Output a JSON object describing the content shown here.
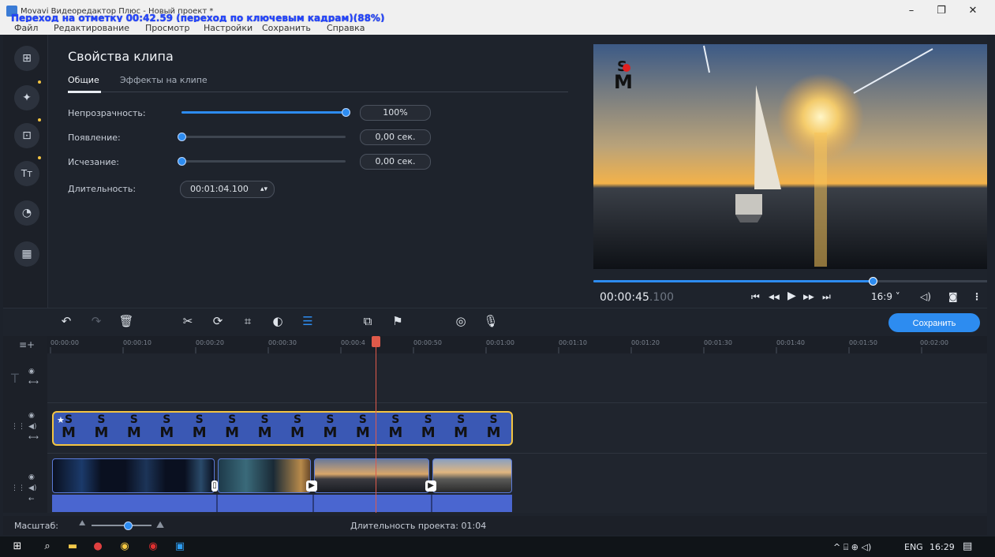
{
  "window": {
    "title": "Movavi Видеоредактор Плюс - Новый проект *",
    "overlay_caption": "Переход на отметку 00:42.59 (переход по ключевым кадрам)(88%)",
    "minimize": "–",
    "maximize": "❐",
    "close": "✕"
  },
  "menu": [
    "Файл",
    "Редактирование",
    "Просмотр",
    "Настройки",
    "Сохранить",
    "Справка"
  ],
  "sidebar": {
    "items": [
      {
        "icon": "import-icon",
        "glyph": "⊞"
      },
      {
        "icon": "filters-icon",
        "glyph": "✦"
      },
      {
        "icon": "transitions-icon",
        "glyph": "⊡"
      },
      {
        "icon": "titles-icon",
        "glyph": "Tт"
      },
      {
        "icon": "stickers-icon",
        "glyph": "◔"
      },
      {
        "icon": "more-tools-icon",
        "glyph": "▦"
      }
    ]
  },
  "clip_properties": {
    "title": "Свойства клипа",
    "tabs": [
      "Общие",
      "Эффекты на клипе"
    ],
    "opacity": {
      "label": "Непрозрачность:",
      "value": "100%",
      "level": 1.0
    },
    "fade_in": {
      "label": "Появление:",
      "value": "0,00 сек.",
      "level": 0.0
    },
    "fade_out": {
      "label": "Исчезание:",
      "value": "0,00 сек.",
      "level": 0.0
    },
    "duration": {
      "label": "Длительность:",
      "value": "00:01:04.100"
    }
  },
  "player": {
    "time": "00:00:45",
    "time_ms": ".100",
    "progress": 0.71,
    "aspect": "16:9 ˅",
    "controls": [
      "⏮",
      "◀◀",
      "▶",
      "▶▶",
      "⏭"
    ]
  },
  "toolbar": {
    "save_label": "Сохранить"
  },
  "ruler": {
    "ticks": [
      "00:00:00",
      "00:00:10",
      "00:00:20",
      "00:00:30",
      "00:00:4",
      "00:00:50",
      "00:01:00",
      "00:01:10",
      "00:01:20",
      "00:01:30",
      "00:01:40",
      "00:01:50",
      "00:02:00"
    ]
  },
  "timeline": {
    "logo_letters": {
      "top": "S",
      "bottom": "M"
    },
    "logo_count": 14
  },
  "status": {
    "zoom_label": "Масштаб:",
    "zoom_level": 0.6,
    "project_duration": "Длительность проекта: 01:04"
  },
  "taskbar": {
    "lang": "ENG",
    "clock": "16:29",
    "tray_icons": "^ ⌸ ⊕ ◁)"
  },
  "colors": {
    "accent": "#2d8cf0",
    "title_clip_border": "#f4c542",
    "playhead": "#e05a4a",
    "clip_blue": "#4a66d0"
  }
}
